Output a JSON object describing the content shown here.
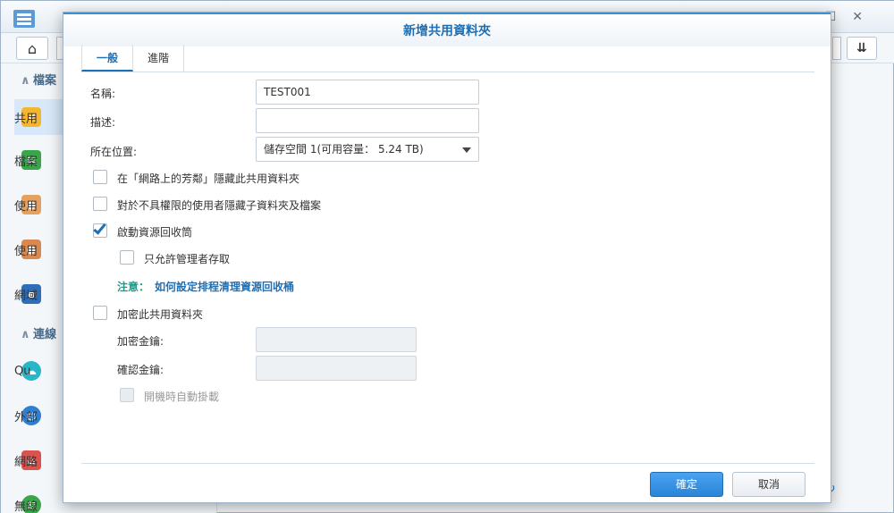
{
  "background": {
    "sidebar": {
      "section1": "檔案",
      "section2": "連線",
      "items": [
        {
          "label": "共用",
          "icon": "shared-folder-icon"
        },
        {
          "label": "檔案",
          "icon": "file-services-icon"
        },
        {
          "label": "使用",
          "icon": "user-icon"
        },
        {
          "label": "使用",
          "icon": "group-icon"
        },
        {
          "label": "網域",
          "icon": "domain-icon"
        },
        {
          "label": "Qu",
          "icon": "quickconnect-icon"
        },
        {
          "label": "外部",
          "icon": "external-access-icon"
        },
        {
          "label": "網路",
          "icon": "network-icon"
        },
        {
          "label": "無線",
          "icon": "wireless-icon"
        }
      ]
    },
    "toolbar": {
      "home_icon": "home-icon",
      "sort_icon": "sort-icon"
    }
  },
  "dialog": {
    "title": "新增共用資料夾",
    "tabs": [
      {
        "label": "一般",
        "active": true
      },
      {
        "label": "進階",
        "active": false
      }
    ],
    "name_label": "名稱:",
    "name_value": "TEST001",
    "desc_label": "描述:",
    "desc_value": "",
    "location_label": "所在位置:",
    "location_value": "儲存空間 1(可用容量： 5.24 TB)",
    "checkbox_hide_network": {
      "label": "在「網路上的芳鄰」隱藏此共用資料夾",
      "checked": false
    },
    "checkbox_hide_sub": {
      "label": "對於不具權限的使用者隱藏子資料夾及檔案",
      "checked": false
    },
    "checkbox_recycle": {
      "label": "啟動資源回收筒",
      "checked": true
    },
    "checkbox_admin_only": {
      "label": "只允許管理者存取",
      "checked": false
    },
    "note_label": "注意：",
    "note_link": "如何設定排程清理資源回收桶",
    "checkbox_encrypt": {
      "label": "加密此共用資料夾",
      "checked": false
    },
    "encrypt_key_label": "加密金鑰:",
    "confirm_key_label": "確認金鑰:",
    "checkbox_automount": {
      "label": "開機時自動掛載",
      "checked": false,
      "disabled": true
    },
    "ok_label": "確定",
    "cancel_label": "取消"
  }
}
